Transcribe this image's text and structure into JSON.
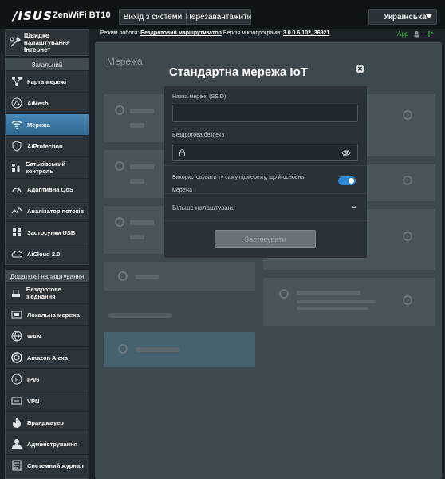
{
  "topbar": {
    "logo": "/ISUS",
    "model": "ZenWiFi BT10",
    "logout_label": "Вихід з системи",
    "reboot_label": "Перезавантажити",
    "language": "Українська"
  },
  "infobar": {
    "mode_label": "Режим роботи:",
    "mode_value": "Бездротовий маршрутизатор",
    "firmware_label": "Версія мікропрограми:",
    "firmware_value": "3.0.0.6.102_36921",
    "app_label": "App"
  },
  "sidebar": {
    "quick_setup": "Швидке налаштування Інтернет",
    "general_title": "Загальний",
    "general_items": [
      {
        "label": "Карта мережі",
        "icon": "network-map-icon"
      },
      {
        "label": "AiMesh",
        "icon": "aimesh-icon"
      },
      {
        "label": "Мережа",
        "icon": "wifi-icon"
      },
      {
        "label": "AiProtection",
        "icon": "aiprotection-icon"
      },
      {
        "label": "Батьківський контроль",
        "icon": "parental-control-icon"
      },
      {
        "label": "Адаптивна QoS",
        "icon": "qos-icon"
      },
      {
        "label": "Аналізатор потоків",
        "icon": "traffic-analyzer-icon"
      },
      {
        "label": "Застосунки USB",
        "icon": "usb-icon"
      },
      {
        "label": "AiCloud 2.0",
        "icon": "aicloud-icon"
      }
    ],
    "advanced_title": "Додаткові налаштування",
    "advanced_items": [
      {
        "label": "Бездротове з'єднання",
        "icon": "wireless-icon"
      },
      {
        "label": "Локальна мережа",
        "icon": "lan-icon"
      },
      {
        "label": "WAN",
        "icon": "wan-icon"
      },
      {
        "label": "Amazon Alexa",
        "icon": "alexa-icon"
      },
      {
        "label": "IPv6",
        "icon": "ipv6-icon"
      },
      {
        "label": "VPN",
        "icon": "vpn-icon"
      },
      {
        "label": "Брандмауер",
        "icon": "firewall-icon"
      },
      {
        "label": "Адміністрування",
        "icon": "admin-icon"
      },
      {
        "label": "Системний журнал",
        "icon": "syslog-icon"
      }
    ]
  },
  "main": {
    "title": "Мережа"
  },
  "modal": {
    "title": "Стандартна мережа IoT",
    "ssid_label": "Назва мережі (SSID)",
    "ssid_value": "",
    "security_label": "Бездротова безпека",
    "security_value": "",
    "subnet_text": "Використовувати ту саму підмережу, що й основна мережа",
    "subnet_toggle_on": true,
    "more_settings": "Більше налаштувань",
    "apply": "Застосувати"
  }
}
